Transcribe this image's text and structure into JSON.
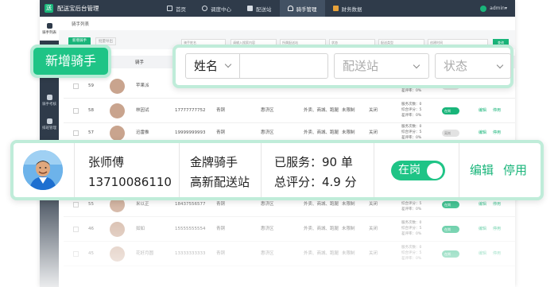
{
  "app": {
    "title": "配送宝后台管理",
    "logo_badge": "送"
  },
  "nav": [
    {
      "label": "首页",
      "icon": "home-icon"
    },
    {
      "label": "调度中心",
      "icon": "dispatch-icon"
    },
    {
      "label": "配送站",
      "icon": "station-icon"
    },
    {
      "label": "骑手管理",
      "icon": "rider-icon",
      "active": true
    },
    {
      "label": "财务数据",
      "icon": "finance-icon"
    }
  ],
  "user": {
    "name": "admin"
  },
  "sidebar": [
    {
      "label": "骑手列表",
      "active": true
    },
    {
      "label": "骑手考核"
    },
    {
      "label": "排班管理"
    }
  ],
  "breadcrumb": "骑手列表",
  "toolbar_mini": {
    "add": "新增骑手",
    "export": "批量导出"
  },
  "filters_mini": [
    "骑手姓名",
    "请输入搜索内容",
    "所属配送站",
    "状态",
    "配送类型",
    "创建时间"
  ],
  "query_label": "查询",
  "table_header_visible": "骑手",
  "bg_rows": [
    {
      "no": "59",
      "name": "苹果派",
      "phone": "",
      "level": "",
      "area": "",
      "type": "",
      "ins": "",
      "ctrl": "",
      "on": false
    },
    {
      "no": "58",
      "name": "林因试",
      "phone": "17777777752",
      "level": "青铜",
      "area": "惠济区",
      "type": "外卖、商城、跑腿",
      "ins": "未限制",
      "ctrl": "关闭",
      "on": true
    },
    {
      "no": "57",
      "name": "迅雷推",
      "phone": "19999999993",
      "level": "青铜",
      "area": "惠济区",
      "type": "外卖、商城、跑腿",
      "ins": "未限制",
      "ctrl": "关闭",
      "on": false
    },
    {
      "no": "55",
      "name": "米以正",
      "phone": "18437556577",
      "level": "青铜",
      "area": "惠济区",
      "type": "外卖、商城、跑腿",
      "ins": "未限制",
      "ctrl": "关闭",
      "on": true
    },
    {
      "no": "46",
      "name": "如如",
      "phone": "15555555554",
      "level": "青铜",
      "area": "惠济区",
      "type": "外卖、商城、跑腿",
      "ins": "未限制",
      "ctrl": "关闭",
      "on": true
    },
    {
      "no": "45",
      "name": "花好月圆",
      "phone": "13333333333",
      "level": "青铜",
      "area": "惠济区",
      "type": "外卖、商城、跑腿",
      "ins": "未限制",
      "ctrl": "关闭",
      "on": true
    }
  ],
  "bg_stats": {
    "line1": "服务次数：0",
    "line2": "综合评分：5",
    "line3": "差评率：0%"
  },
  "bg_toggle": {
    "on": "在岗",
    "off": "离岗"
  },
  "bg_actions": {
    "edit": "编辑",
    "disable": "停用"
  },
  "add_button": {
    "label": "新增骑手"
  },
  "filter_panel": {
    "field_select": "姓名",
    "search_value": "",
    "station_placeholder": "配送站",
    "status_placeholder": "状态"
  },
  "rider": {
    "name": "张师傅",
    "phone": "13710086110",
    "level": "金牌骑手",
    "station": "高新配送站",
    "served": "已服务：90 单",
    "score": "总评分：4.9 分",
    "status": "在岗",
    "edit": "编辑",
    "disable": "停用"
  },
  "colors": {
    "accent": "#1fc486",
    "topbar": "#2f3b4a",
    "glow": "#bfecd9"
  }
}
